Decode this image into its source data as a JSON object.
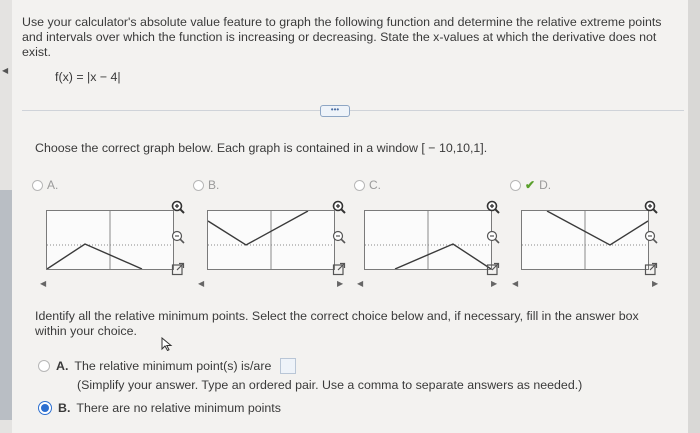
{
  "question": {
    "text": "Use your calculator's absolute value feature to graph the following function and determine the relative extreme points and intervals over which the function is increasing or decreasing. State the x-values at which the derivative does not exist.",
    "function": "f(x) = |x − 4|",
    "more_label": "•••"
  },
  "graph_prompt": "Choose the correct graph below. Each graph is contained in a window [ − 10,10,1].",
  "graph_choices": [
    {
      "letter": "A.",
      "selected": false
    },
    {
      "letter": "B.",
      "selected": false
    },
    {
      "letter": "C.",
      "selected": false
    },
    {
      "letter": "D.",
      "selected": true
    }
  ],
  "graph_tools": [
    "zoom-in-icon",
    "zoom-out-icon",
    "zoom-out-icon",
    "popout-icon"
  ],
  "part2": {
    "prompt": "Identify all the relative minimum points. Select the correct choice below and, if necessary, fill in the answer box within your choice.",
    "option_a": {
      "letter": "A.",
      "text": "The relative minimum point(s) is/are",
      "note": "(Simplify your answer. Type an ordered pair. Use a comma to separate answers as needed.)"
    },
    "option_b": {
      "letter": "B.",
      "text": "There are no relative minimum points",
      "selected": true
    }
  },
  "colors": {
    "selected_radio": "#2c6fd0",
    "correct_check": "#5aa02c",
    "graph_line": "#3a3a3a"
  }
}
